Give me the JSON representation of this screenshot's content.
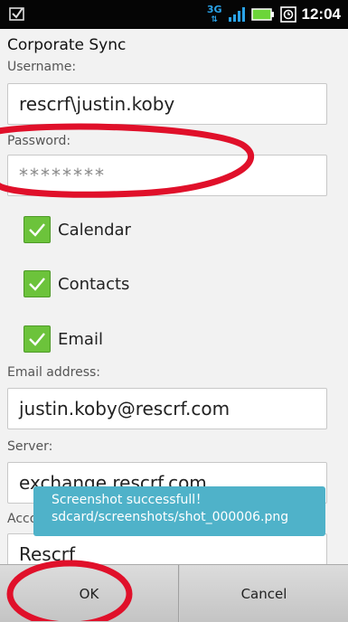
{
  "status_bar": {
    "network_type": "3G",
    "time": "12:04",
    "icons": [
      "notification-icon",
      "signal-icon",
      "battery-icon",
      "alarm-icon"
    ]
  },
  "screen": {
    "title": "Corporate Sync",
    "username": {
      "label": "Username:",
      "value": "rescrf\\justin.koby"
    },
    "password": {
      "label": "Password:",
      "value": "********"
    },
    "sync_options": [
      {
        "label": "Calendar",
        "checked": true
      },
      {
        "label": "Contacts",
        "checked": true
      },
      {
        "label": "Email",
        "checked": true
      }
    ],
    "email_address": {
      "label": "Email address:",
      "value": "justin.koby@rescrf.com"
    },
    "server": {
      "label": "Server:",
      "value": "exchange.rescrf.com"
    },
    "account": {
      "label": "Accou",
      "value": "Rescrf"
    }
  },
  "toast": {
    "line1": "Screenshot successfull！",
    "line2": "sdcard/screenshots/shot_000006.png"
  },
  "buttons": {
    "ok": "OK",
    "cancel": "Cancel"
  },
  "colors": {
    "status_bar_bg": "#050505",
    "checkbox_green": "#6cc33b",
    "toast_bg": "#4fb2c9",
    "annotation_red": "#e0102a"
  }
}
